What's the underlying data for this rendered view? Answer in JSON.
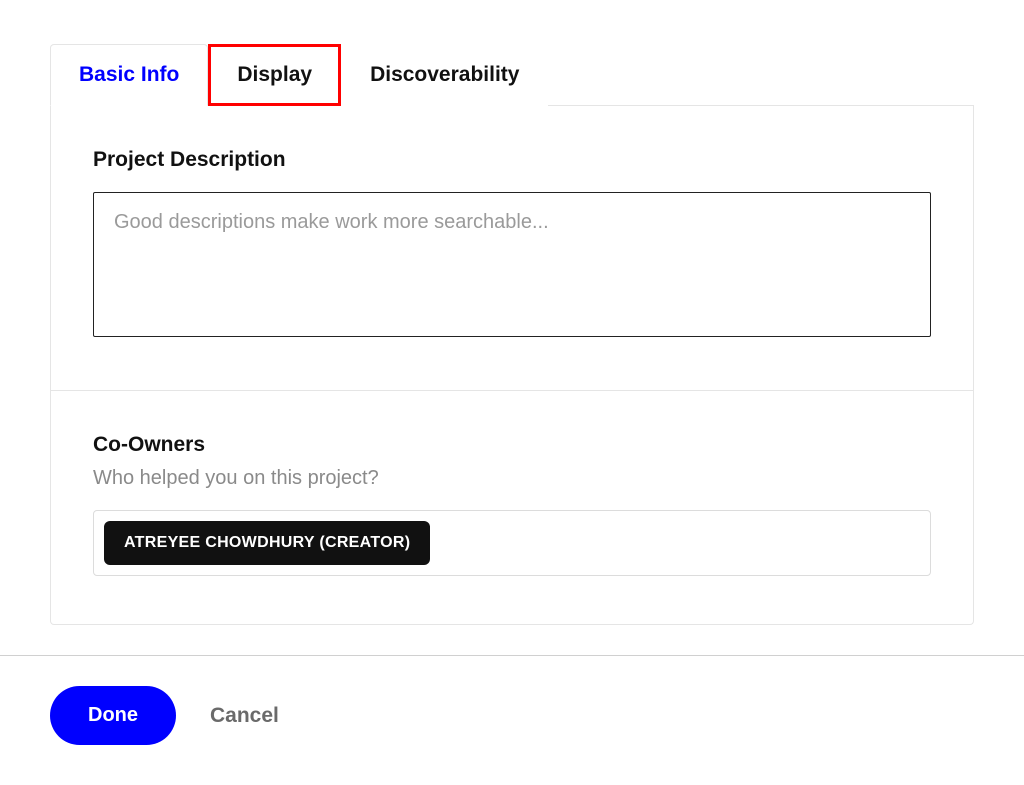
{
  "tabs": {
    "basic_info": "Basic Info",
    "display": "Display",
    "discoverability": "Discoverability"
  },
  "description": {
    "title": "Project Description",
    "placeholder": "Good descriptions make work more searchable...",
    "value": ""
  },
  "coowners": {
    "title": "Co-Owners",
    "subtitle": "Who helped you on this project?",
    "chips": [
      "ATREYEE CHOWDHURY (CREATOR)"
    ]
  },
  "footer": {
    "done": "Done",
    "cancel": "Cancel"
  }
}
